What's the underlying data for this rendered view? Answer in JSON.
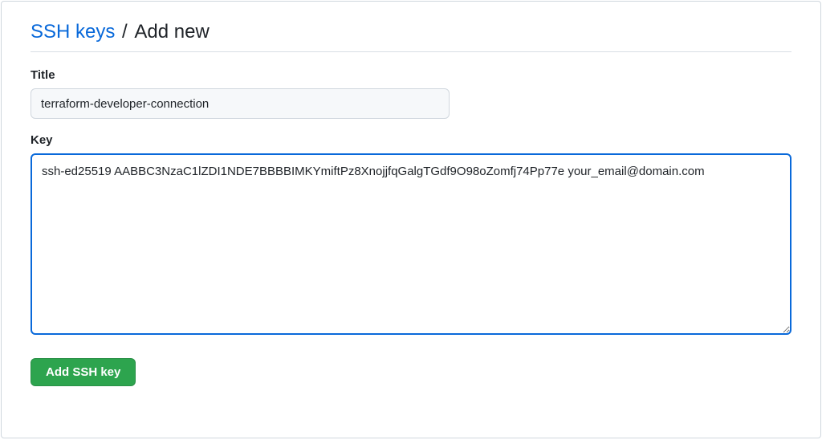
{
  "header": {
    "link_text": "SSH keys",
    "separator": " / ",
    "current": "Add new"
  },
  "form": {
    "title_label": "Title",
    "title_value": "terraform-developer-connection",
    "key_label": "Key",
    "key_value": "ssh-ed25519 AABBC3NzaC1lZDI1NDE7BBBBIMKYmiftPz8XnojjfqGalgTGdf9O98oZomfj74Pp77e your_email@domain.com"
  },
  "button": {
    "submit_label": "Add SSH key"
  }
}
